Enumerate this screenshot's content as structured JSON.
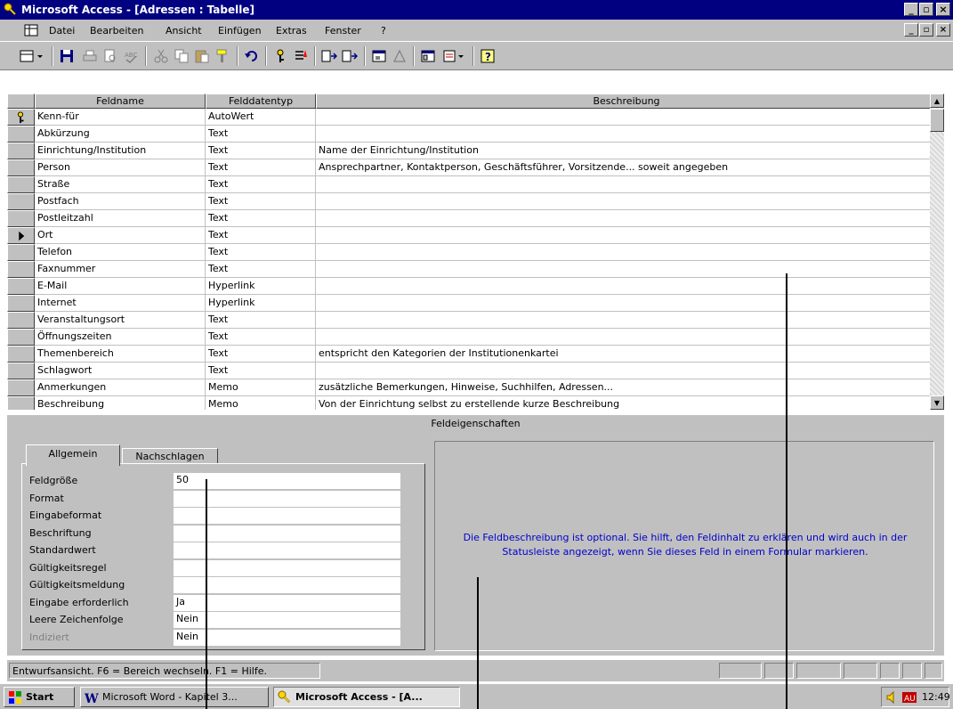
{
  "window": {
    "title": "Microsoft Access - [Adressen : Tabelle]"
  },
  "menu": {
    "items": [
      "Datei",
      "Bearbeiten",
      "Ansicht",
      "Einfügen",
      "Extras",
      "Fenster",
      "?"
    ]
  },
  "toolbar": {
    "buttons": [
      "view-icon",
      "save-icon",
      "print-icon",
      "print-preview-icon",
      "spelling-icon",
      "cut-icon",
      "copy-icon",
      "paste-icon",
      "format-painter-icon",
      "undo-icon",
      "primary-key-icon",
      "indexes-icon",
      "insert-rows-icon",
      "delete-rows-icon",
      "properties-icon",
      "build-icon",
      "database-window-icon",
      "new-object-icon",
      "help-icon"
    ]
  },
  "grid": {
    "columns": [
      "Feldname",
      "Felddatentyp",
      "Beschreibung"
    ],
    "rows": [
      {
        "name": "Kenn-für",
        "type": "AutoWert",
        "desc": "",
        "marker": "key"
      },
      {
        "name": "Abkürzung",
        "type": "Text",
        "desc": "",
        "marker": ""
      },
      {
        "name": "Einrichtung/Institution",
        "type": "Text",
        "desc": "Name der Einrichtung/Institution",
        "marker": ""
      },
      {
        "name": "Person",
        "type": "Text",
        "desc": "Ansprechpartner, Kontaktperson, Geschäftsführer, Vorsitzende... soweit angegeben",
        "marker": ""
      },
      {
        "name": "Straße",
        "type": "Text",
        "desc": "",
        "marker": ""
      },
      {
        "name": "Postfach",
        "type": "Text",
        "desc": "",
        "marker": ""
      },
      {
        "name": "Postleitzahl",
        "type": "Text",
        "desc": "",
        "marker": ""
      },
      {
        "name": "Ort",
        "type": "Text",
        "desc": "",
        "marker": "current"
      },
      {
        "name": "Telefon",
        "type": "Text",
        "desc": "",
        "marker": ""
      },
      {
        "name": "Faxnummer",
        "type": "Text",
        "desc": "",
        "marker": ""
      },
      {
        "name": "E-Mail",
        "type": "Hyperlink",
        "desc": "",
        "marker": ""
      },
      {
        "name": "Internet",
        "type": "Hyperlink",
        "desc": "",
        "marker": ""
      },
      {
        "name": "Veranstaltungsort",
        "type": "Text",
        "desc": "",
        "marker": ""
      },
      {
        "name": "Öffnungszeiten",
        "type": "Text",
        "desc": "",
        "marker": ""
      },
      {
        "name": "Themenbereich",
        "type": "Text",
        "desc": "entspricht den Kategorien der Institutionenkartei",
        "marker": ""
      },
      {
        "name": "Schlagwort",
        "type": "Text",
        "desc": "",
        "marker": ""
      },
      {
        "name": "Anmerkungen",
        "type": "Memo",
        "desc": "zusätzliche Bemerkungen, Hinweise, Suchhilfen, Adressen...",
        "marker": ""
      },
      {
        "name": "Beschreibung",
        "type": "Memo",
        "desc": "Von der Einrichtung selbst zu erstellende kurze Beschreibung",
        "marker": ""
      }
    ]
  },
  "properties": {
    "title": "Feldeigenschaften",
    "tabs": [
      "Allgemein",
      "Nachschlagen"
    ],
    "fields": [
      {
        "label": "Feldgröße",
        "value": "50"
      },
      {
        "label": "Format",
        "value": ""
      },
      {
        "label": "Eingabeformat",
        "value": ""
      },
      {
        "label": "Beschriftung",
        "value": ""
      },
      {
        "label": "Standardwert",
        "value": ""
      },
      {
        "label": "Gültigkeitsregel",
        "value": ""
      },
      {
        "label": "Gültigkeitsmeldung",
        "value": ""
      },
      {
        "label": "Eingabe erforderlich",
        "value": "Ja"
      },
      {
        "label": "Leere Zeichenfolge",
        "value": "Nein"
      },
      {
        "label": "Indiziert",
        "value": "Nein"
      }
    ],
    "help": "Die Feldbeschreibung ist optional. Sie hilft, den Feldinhalt zu erklären und wird auch in der Statusleiste angezeigt, wenn Sie dieses Feld in einem Formular markieren."
  },
  "status": {
    "text": "Entwurfsansicht. F6 = Bereich wechseln. F1 = Hilfe."
  },
  "taskbar": {
    "start": "Start",
    "tasks": [
      "Microsoft Word - Kapitel 3...",
      "Microsoft Access - [A..."
    ],
    "clock": "12:49"
  },
  "colors": {
    "titlebar": "#000080",
    "face": "#c0c0c0",
    "helptext": "#0000cc"
  }
}
